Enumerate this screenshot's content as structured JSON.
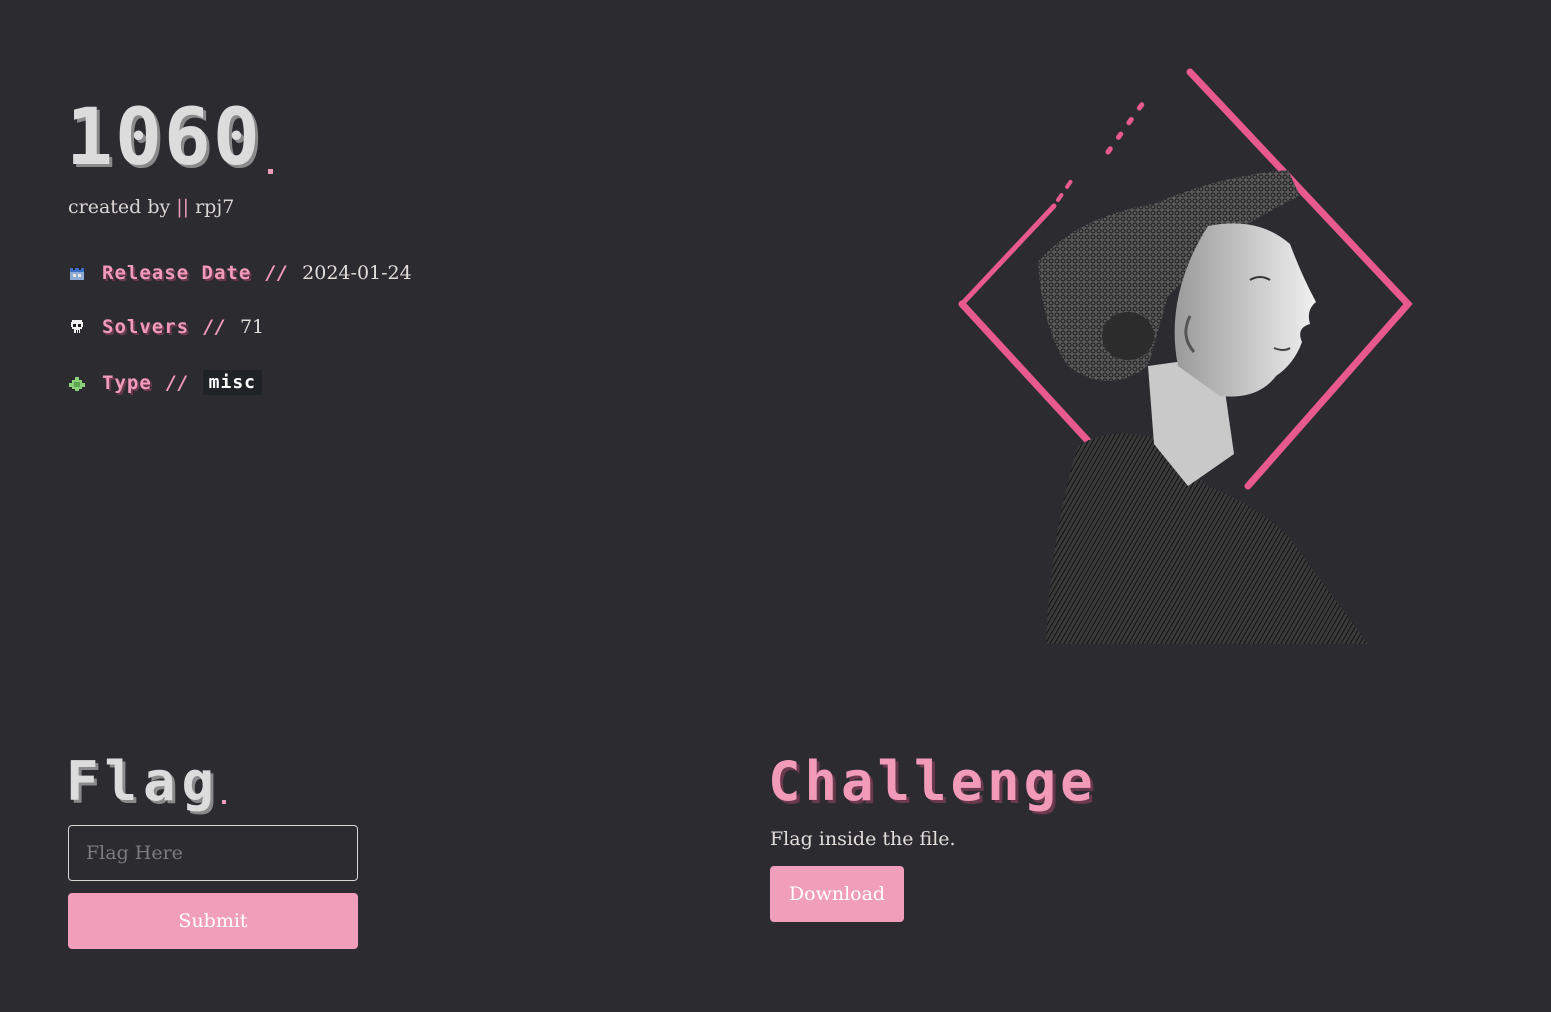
{
  "challenge": {
    "title": "1060",
    "created_by_label": "created by",
    "separator": "||",
    "author": "rpj7"
  },
  "meta": {
    "release_date": {
      "icon": "calendar-icon",
      "label": "Release Date",
      "slash": "//",
      "value": "2024-01-24"
    },
    "solvers": {
      "icon": "skull-icon",
      "label": "Solvers",
      "slash": "//",
      "value": "71"
    },
    "type": {
      "icon": "puzzle-icon",
      "label": "Type",
      "slash": "//",
      "value": "misc"
    }
  },
  "flag_section": {
    "heading": "Flag",
    "input_placeholder": "Flag Here",
    "input_value": "",
    "submit_label": "Submit"
  },
  "challenge_section": {
    "heading": "Challenge",
    "description": "Flag inside the file.",
    "download_label": "Download"
  },
  "colors": {
    "background": "#2c2b30",
    "accent_pink": "#f19eba",
    "text_light": "#e1deda",
    "frame_pink": "#e85a8e"
  }
}
